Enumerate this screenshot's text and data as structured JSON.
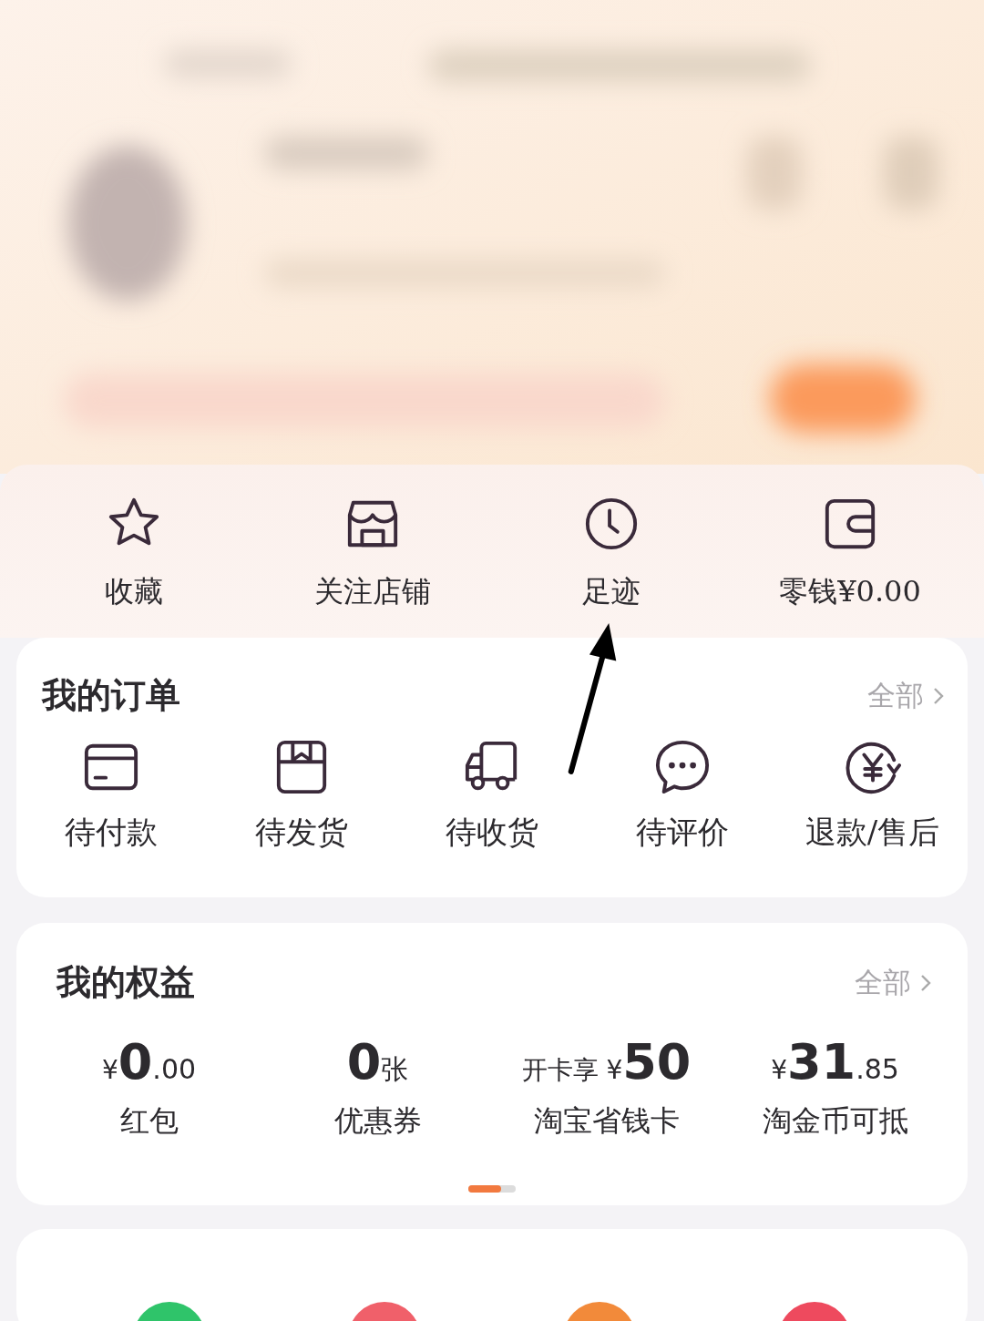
{
  "shortcuts": [
    {
      "kind": "star",
      "label": "收藏"
    },
    {
      "kind": "shop",
      "label": "关注店铺"
    },
    {
      "kind": "clock",
      "label": "足迹"
    },
    {
      "kind": "wallet",
      "label": "零钱¥0.00"
    }
  ],
  "orders": {
    "title": "我的订单",
    "more": "全部",
    "items": [
      {
        "kind": "card",
        "label": "待付款"
      },
      {
        "kind": "box",
        "label": "待发货"
      },
      {
        "kind": "truck",
        "label": "待收货"
      },
      {
        "kind": "chat",
        "label": "待评价"
      },
      {
        "kind": "refund",
        "label": "退款/售后"
      }
    ]
  },
  "benefits": {
    "title": "我的权益",
    "more": "全部",
    "items": [
      {
        "prefix": "¥",
        "main": "0",
        "suffix": ".00",
        "label": "红包"
      },
      {
        "main": "0",
        "suffix": "张",
        "label": "优惠券"
      },
      {
        "prefix": "开卡享 ¥",
        "main": "50",
        "label": "淘宝省钱卡"
      },
      {
        "prefix": "¥",
        "main": "31",
        "suffix": ".85",
        "label": "淘金币可抵"
      }
    ]
  },
  "services": [
    {
      "color": "#2fc46a"
    },
    {
      "color": "#f0606a"
    },
    {
      "color": "#f28a3a"
    },
    {
      "color": "#ee4a5e"
    }
  ]
}
